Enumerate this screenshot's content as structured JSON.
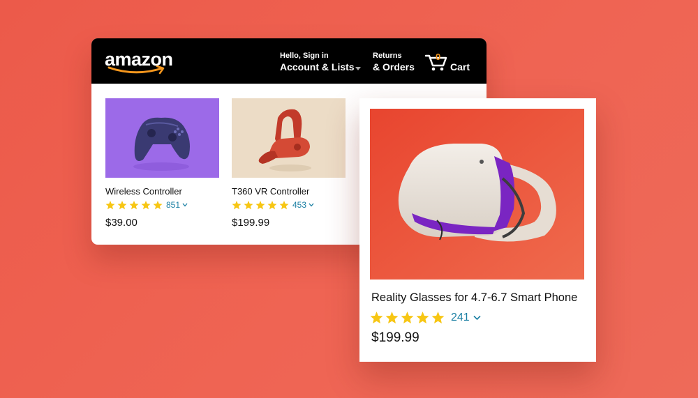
{
  "header": {
    "logo_text": "amazon",
    "account_small": "Hello, Sign in",
    "account_big": "Account & Lists",
    "returns_small": "Returns",
    "returns_big": "& Orders",
    "cart_count": "0",
    "cart_label": "Cart"
  },
  "products": [
    {
      "title": "Wireless Controller",
      "stars": 5,
      "review_count": "851",
      "price": "$39.00",
      "image": "purple-gamepad"
    },
    {
      "title": "T360 VR Controller",
      "stars": 5,
      "review_count": "453",
      "price": "$199.99",
      "image": "red-vr-controller"
    }
  ],
  "featured": {
    "title": "Reality Glasses for 4.7-6.7 Smart Phone",
    "stars": 5,
    "review_count": "241",
    "price": "$199.99",
    "image": "vr-headset"
  },
  "colors": {
    "background": "#ec5a4a",
    "header_bg": "#000000",
    "star": "#f7c613",
    "review_link": "#1a7fa3",
    "cart_count": "#f6971d",
    "smile": "#f6971d"
  }
}
